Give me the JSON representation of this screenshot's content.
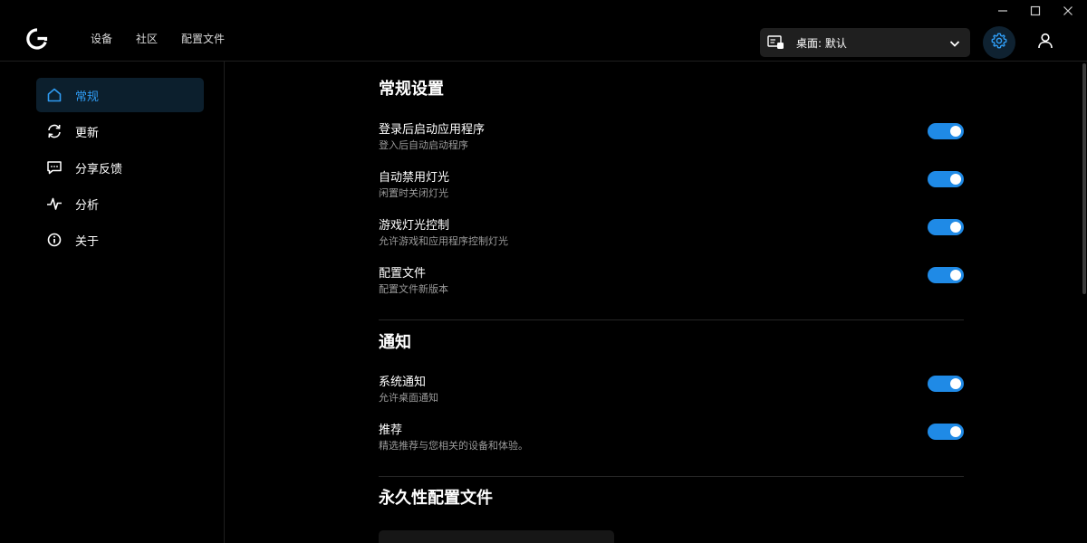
{
  "header": {
    "nav": [
      "设备",
      "社区",
      "配置文件"
    ],
    "profile_label": "桌面: 默认"
  },
  "sidebar": {
    "items": [
      {
        "label": "常规",
        "icon": "home-icon",
        "active": true
      },
      {
        "label": "更新",
        "icon": "refresh-icon",
        "active": false
      },
      {
        "label": "分享反馈",
        "icon": "feedback-icon",
        "active": false
      },
      {
        "label": "分析",
        "icon": "analytics-icon",
        "active": false
      },
      {
        "label": "关于",
        "icon": "info-icon",
        "active": false
      }
    ]
  },
  "main": {
    "general": {
      "title": "常规设置",
      "settings": [
        {
          "title": "登录后启动应用程序",
          "desc": "登入后自动启动程序",
          "on": true
        },
        {
          "title": "自动禁用灯光",
          "desc": "闲置时关闭灯光",
          "on": true
        },
        {
          "title": "游戏灯光控制",
          "desc": "允许游戏和应用程序控制灯光",
          "on": true
        },
        {
          "title": "配置文件",
          "desc": "配置文件新版本",
          "on": true
        }
      ]
    },
    "notifications": {
      "title": "通知",
      "settings": [
        {
          "title": "系统通知",
          "desc": "允许桌面通知",
          "on": true
        },
        {
          "title": "推荐",
          "desc": "精选推荐与您相关的设备和体验。",
          "on": true
        }
      ]
    },
    "persistent": {
      "title": "永久性配置文件"
    }
  },
  "colors": {
    "accent": "#1f8ae6",
    "background": "#000000",
    "active_bg": "#0c1f2d"
  }
}
